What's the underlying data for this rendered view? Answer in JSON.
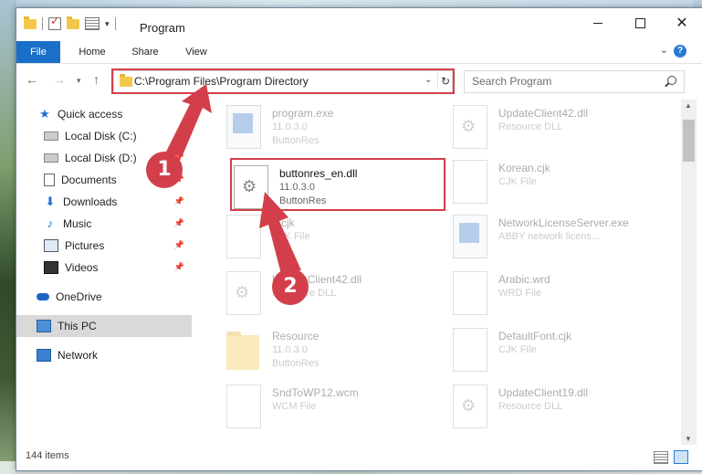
{
  "window": {
    "title": "Program"
  },
  "ribbon": {
    "tabs": [
      "File",
      "Home",
      "Share",
      "View"
    ]
  },
  "address": {
    "path": "C:\\Program Files\\Program Directory"
  },
  "search": {
    "placeholder": "Search Program"
  },
  "sidebar": {
    "items": [
      {
        "label": "Quick access",
        "icon": "star-icon"
      },
      {
        "label": "Local Disk (C:)",
        "icon": "disk-icon"
      },
      {
        "label": "Local Disk (D:)",
        "icon": "disk-icon"
      },
      {
        "label": "Documents",
        "icon": "document-icon"
      },
      {
        "label": "Downloads",
        "icon": "download-icon"
      },
      {
        "label": "Music",
        "icon": "music-icon"
      },
      {
        "label": "Pictures",
        "icon": "pictures-icon"
      },
      {
        "label": "Videos",
        "icon": "videos-icon"
      },
      {
        "label": "OneDrive",
        "icon": "cloud-icon"
      },
      {
        "label": "This PC",
        "icon": "computer-icon"
      },
      {
        "label": "Network",
        "icon": "network-icon"
      }
    ]
  },
  "files": [
    {
      "name": "program.exe",
      "meta1": "11.0.3.0",
      "meta2": "ButtonRes"
    },
    {
      "name": "UpdateClient42.dll",
      "meta1": "Resource DLL",
      "meta2": ""
    },
    {
      "name": "buttonres_en.dll",
      "meta1": "11.0.3.0",
      "meta2": "ButtonRes"
    },
    {
      "name": "Korean.cjk",
      "meta1": "CJK File",
      "meta2": ""
    },
    {
      "name": "...cjk",
      "meta1": "CJK File",
      "meta2": ""
    },
    {
      "name": "NetworkLicenseServer.exe",
      "meta1": "ABBY network licens...",
      "meta2": ""
    },
    {
      "name": "UpdateClient42.dll",
      "meta1": "Resource DLL",
      "meta2": ""
    },
    {
      "name": "Arabic.wrd",
      "meta1": "WRD File",
      "meta2": ""
    },
    {
      "name": "Resource",
      "meta1": "11.0.3.0",
      "meta2": "ButtonRes"
    },
    {
      "name": "DefaultFont.cjk",
      "meta1": "CJK File",
      "meta2": ""
    },
    {
      "name": "SndToWP12.wcm",
      "meta1": "WCM File",
      "meta2": ""
    },
    {
      "name": "UpdateClient19.dll",
      "meta1": "Resource DLL",
      "meta2": ""
    }
  ],
  "status": {
    "count": "144 items"
  },
  "callouts": [
    "1",
    "2"
  ],
  "colors": {
    "highlight": "#d23f4a",
    "accent": "#1a6fc9"
  }
}
